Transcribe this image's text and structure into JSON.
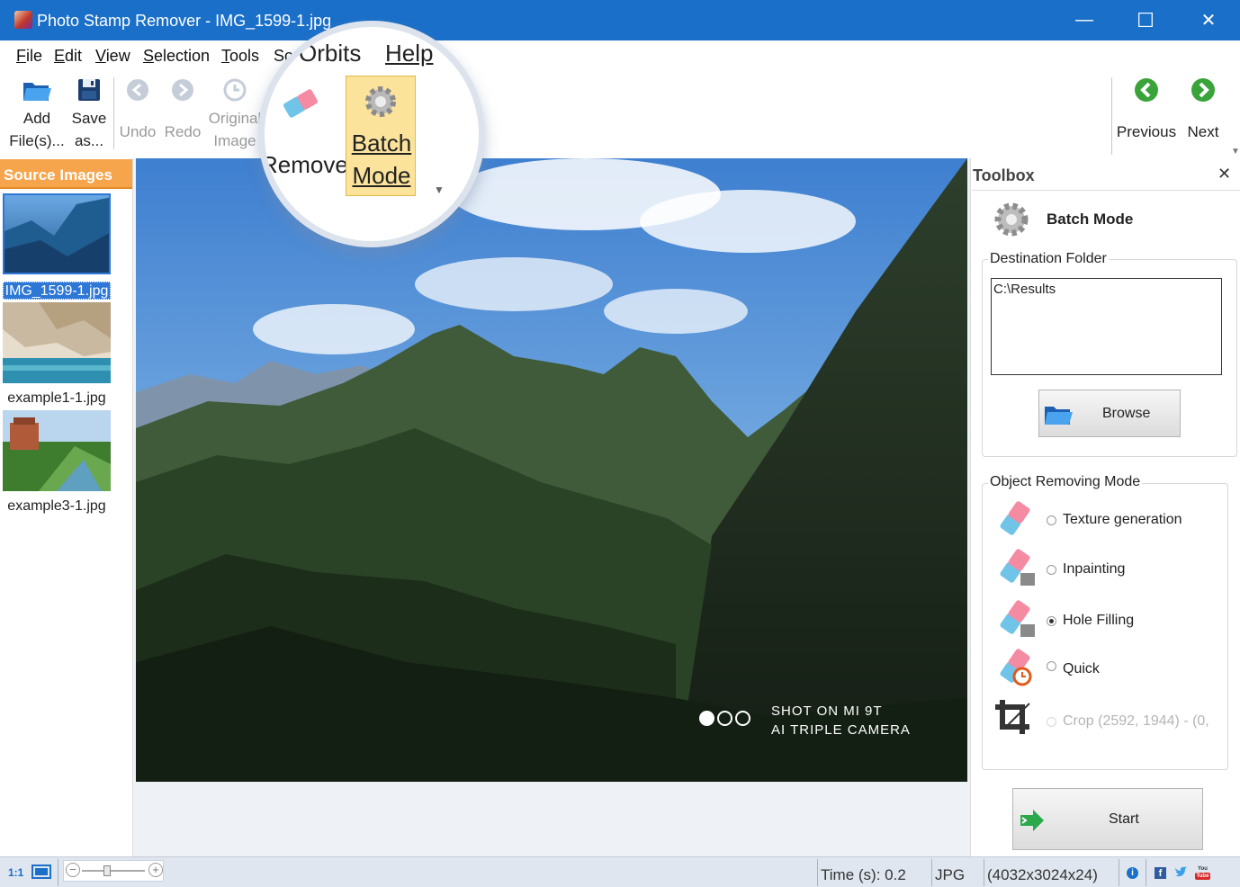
{
  "window": {
    "title": "Photo Stamp Remover - IMG_1599-1.jpg",
    "minimize": "—",
    "maximize": "☐",
    "close": "✕"
  },
  "menu": {
    "file": {
      "key": "F",
      "rest": "ile"
    },
    "edit": {
      "key": "E",
      "rest": "dit"
    },
    "view": {
      "key": "V",
      "rest": "iew"
    },
    "selection": {
      "key": "S",
      "rest": "election"
    },
    "tools": {
      "key": "T",
      "rest": "ools"
    },
    "softorbits_partial": "So",
    "magnified_softorbits": "Orbits",
    "magnified_help": "Help"
  },
  "toolbar": {
    "add_line1": "Add",
    "add_line2": "File(s)...",
    "save_line1": "Save",
    "save_line2": "as...",
    "undo": "Undo",
    "redo": "Redo",
    "original_line1": "Original",
    "original_line2": "Image",
    "remove": "Remove",
    "batch_line1": "Batch",
    "batch_line2": "Mode",
    "previous": "Previous",
    "next": "Next"
  },
  "source_images": {
    "header": "Source Images",
    "items": [
      {
        "label": "IMG_1599-1.jpg",
        "selected": true
      },
      {
        "label": "example1-1.jpg",
        "selected": false
      },
      {
        "label": "example3-1.jpg",
        "selected": false
      }
    ]
  },
  "photo_watermark": {
    "line1": "SHOT ON MI 9T",
    "line2": "AI TRIPLE CAMERA"
  },
  "toolbox": {
    "title": "Toolbox",
    "close": "✕",
    "section_title": "Batch Mode",
    "destination_label": "Destination Folder",
    "destination_value": "C:\\Results",
    "browse": "Browse",
    "mode_label": "Object Removing Mode",
    "modes": [
      {
        "label": "Texture generation",
        "selected": false
      },
      {
        "label": "Inpainting",
        "selected": false
      },
      {
        "label": "Hole Filling",
        "selected": true
      },
      {
        "label": "Quick",
        "selected": false
      }
    ],
    "crop_label": "Crop (2592, 1944) - (0,",
    "start": "Start"
  },
  "status": {
    "scale": "1:1",
    "time": "Time (s): 0.2",
    "format": "JPG",
    "dimensions": "(4032x3024x24)",
    "zoom_percent": 40
  },
  "colors": {
    "titlebar": "#1a6fc9",
    "source_header": "#f6a54c",
    "selection": "#2d77d6",
    "batch_highlight": "#fbe39b",
    "nav_green": "#3aa33a"
  }
}
